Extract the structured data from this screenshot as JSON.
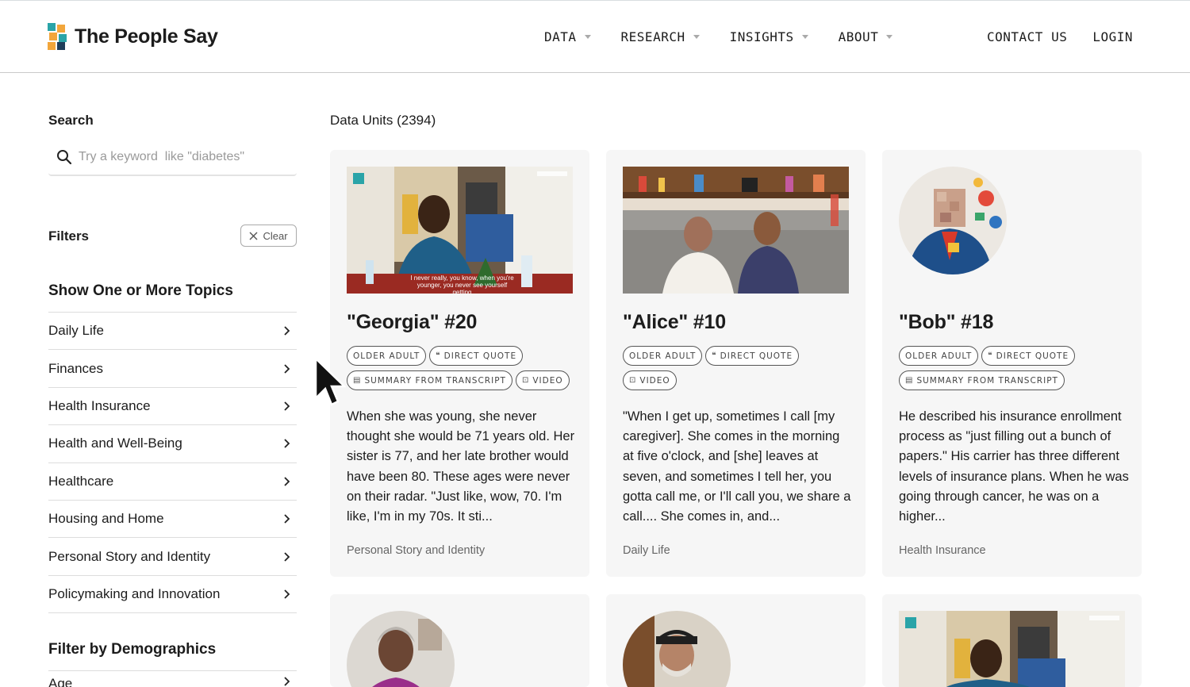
{
  "header": {
    "logo_text": "The People Say",
    "nav": [
      {
        "label": "DATA"
      },
      {
        "label": "RESEARCH"
      },
      {
        "label": "INSIGHTS"
      },
      {
        "label": "ABOUT"
      }
    ],
    "contact_label": "CONTACT US",
    "login_label": "LOGIN"
  },
  "sidebar": {
    "search_title": "Search",
    "search_placeholder": "Try a keyword  like \"diabetes\"",
    "filters_title": "Filters",
    "clear_label": "Clear",
    "topics_title": "Show One or More Topics",
    "topics": [
      {
        "label": "Daily Life"
      },
      {
        "label": "Finances"
      },
      {
        "label": "Health Insurance"
      },
      {
        "label": "Health and Well-Being"
      },
      {
        "label": "Healthcare"
      },
      {
        "label": "Housing and Home"
      },
      {
        "label": "Personal Story and Identity"
      },
      {
        "label": "Policymaking and Innovation"
      }
    ],
    "demographics_title": "Filter by Demographics",
    "demographics_first": "Age"
  },
  "main": {
    "units_count": "Data Units (2394)",
    "cards": [
      {
        "title": "\"Georgia\" #20",
        "tags": [
          {
            "label": "OLDER ADULT",
            "icon": ""
          },
          {
            "label": "DIRECT QUOTE",
            "icon": "quote-icon"
          },
          {
            "label": "SUMMARY FROM TRANSCRIPT",
            "icon": "transcript-icon"
          },
          {
            "label": "VIDEO",
            "icon": "video-icon"
          }
        ],
        "text": "When she was young, she never thought she would be 71 years old. Her sister is 77, and her late brother would have been 80. These ages were never on their radar. \"Just like, wow, 70. I'm like, I'm in my 70s. It sti...",
        "topic": "Personal Story and Identity",
        "caption": "I never really, you know, when you're younger, you never see yourself getting"
      },
      {
        "title": "\"Alice\" #10",
        "tags": [
          {
            "label": "OLDER ADULT",
            "icon": ""
          },
          {
            "label": "DIRECT QUOTE",
            "icon": "quote-icon"
          },
          {
            "label": "VIDEO",
            "icon": "video-icon"
          }
        ],
        "text": "\"When I get up, sometimes I call [my caregiver]. She comes in the morning at five o'clock, and [she] leaves at seven, and sometimes I tell her, you gotta call me, or I'll call you, we share a call.... She comes in, and...",
        "topic": "Daily Life"
      },
      {
        "title": "\"Bob\" #18",
        "tags": [
          {
            "label": "OLDER ADULT",
            "icon": ""
          },
          {
            "label": "DIRECT QUOTE",
            "icon": "quote-icon"
          },
          {
            "label": "SUMMARY FROM TRANSCRIPT",
            "icon": "transcript-icon"
          }
        ],
        "text": "He described his insurance enrollment process as \"just filling out a bunch of papers.\" His carrier has three different levels of insurance plans. When he was going through cancer, he was on a higher...",
        "topic": "Health Insurance"
      }
    ]
  },
  "colors": {
    "logo_orange": "#f2a63b",
    "logo_teal": "#2aa4a8",
    "logo_navy": "#1f3d5a",
    "card_bg": "#f6f6f6"
  }
}
